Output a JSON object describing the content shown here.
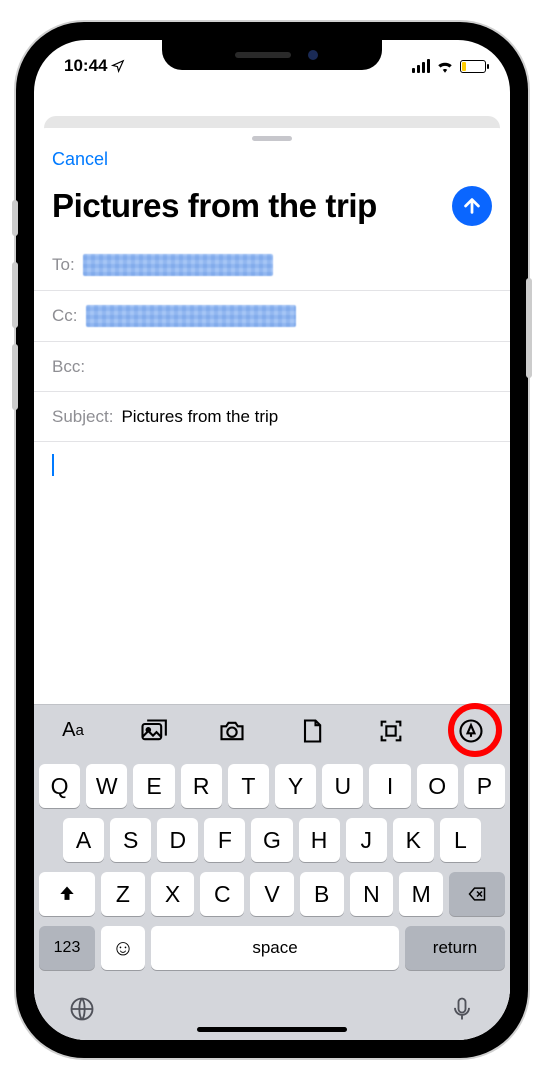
{
  "statusbar": {
    "time": "10:44"
  },
  "nav": {
    "cancel": "Cancel"
  },
  "compose": {
    "title": "Pictures from the trip",
    "to_label": "To:",
    "cc_label": "Cc:",
    "bcc_label": "Bcc:",
    "subject_label": "Subject:",
    "subject_value": "Pictures from the trip"
  },
  "toolbar": {
    "format": "Aa"
  },
  "keyboard": {
    "row1": [
      "Q",
      "W",
      "E",
      "R",
      "T",
      "Y",
      "U",
      "I",
      "O",
      "P"
    ],
    "row2": [
      "A",
      "S",
      "D",
      "F",
      "G",
      "H",
      "J",
      "K",
      "L"
    ],
    "row3": [
      "Z",
      "X",
      "C",
      "V",
      "B",
      "N",
      "M"
    ],
    "numbers": "123",
    "space": "space",
    "return": "return"
  }
}
